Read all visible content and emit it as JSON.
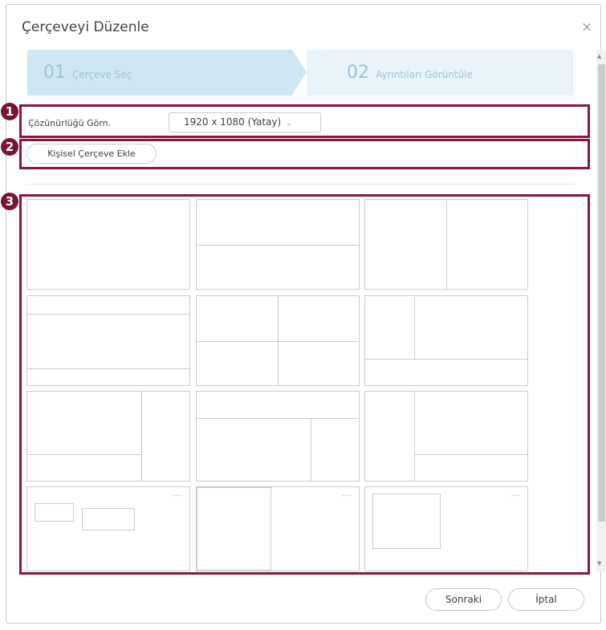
{
  "dialog": {
    "title": "Çerçeveyi Düzenle",
    "close_glyph": "×"
  },
  "steps": [
    {
      "num": "01",
      "label": "Çerçeve Seç"
    },
    {
      "num": "02",
      "label": "Ayrıntıları Görüntüle"
    }
  ],
  "resolution": {
    "label": "Çözünürlüğü Görn.",
    "value": "1920 x 1080 (Yatay)",
    "chevron": "⌄"
  },
  "custom_frame_button": "Kişisel Çerçeve Ekle",
  "thumbnail_menu_glyph": "···",
  "callouts": [
    "1",
    "2",
    "3"
  ],
  "footer": {
    "next": "Sonraki",
    "cancel": "İptal"
  },
  "colors": {
    "callout_border": "#8b1640",
    "step_active": "#cfe7f3",
    "step_inactive": "#e8f4fa"
  }
}
